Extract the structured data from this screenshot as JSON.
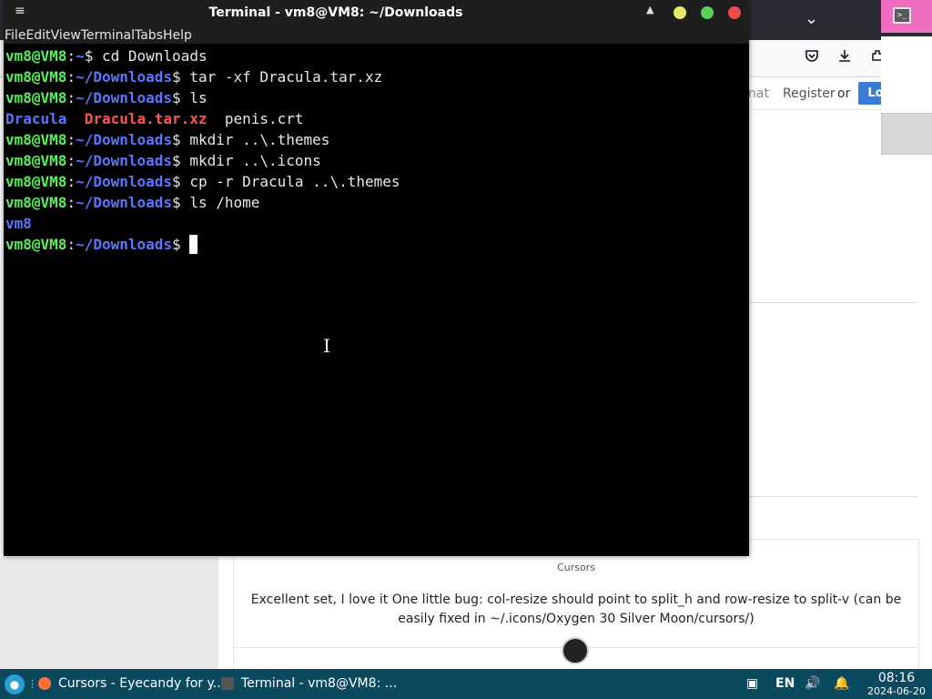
{
  "browser": {
    "header_hidden": "nat",
    "register": "Register",
    "or": "or",
    "login": "Login",
    "card_category": "Cursors",
    "comment": "Excellent set, I love it One little bug: col-resize should point to split_h and row-resize to split-v (can be easily fixed in ~/.icons/Oxygen 30 Silver Moon/cursors/)"
  },
  "terminal": {
    "title": "Terminal - vm8@VM8: ~/Downloads",
    "menu": [
      "File",
      "Edit",
      "View",
      "Terminal",
      "Tabs",
      "Help"
    ],
    "user": "vm8@VM8",
    "lines": [
      {
        "path": "~",
        "cmd": "cd Downloads"
      },
      {
        "path": "~/Downloads",
        "cmd": "tar -xf Dracula.tar.xz"
      },
      {
        "path": "~/Downloads",
        "cmd": "ls"
      },
      {
        "ls": [
          "Dracula",
          "Dracula.tar.xz",
          "penis.crt"
        ]
      },
      {
        "path": "~/Downloads",
        "cmd": "mkdir ..\\.themes"
      },
      {
        "path": "~/Downloads",
        "cmd": "mkdir ..\\.icons"
      },
      {
        "path": "~/Downloads",
        "cmd": "cp -r Dracula ..\\.themes"
      },
      {
        "path": "~/Downloads",
        "cmd": "ls /home"
      },
      {
        "out": "vm8"
      },
      {
        "path": "~/Downloads",
        "cmd": "",
        "cursor": true
      }
    ]
  },
  "taskbar": {
    "tasks": [
      {
        "label": "Cursors - Eyecandy for y...",
        "icon": "firefox-icon"
      },
      {
        "label": "Terminal - vm8@VM8: ...",
        "icon": "terminal-icon"
      }
    ],
    "lang": "EN",
    "time": "08:16",
    "date": "2024-06-20"
  },
  "colors": {
    "prompt_user": "#5af05a",
    "prompt_path": "#5c75ff",
    "archive": "#ff5454",
    "taskbar": "#0b4a5e",
    "login_button": "#3a7bd5"
  }
}
